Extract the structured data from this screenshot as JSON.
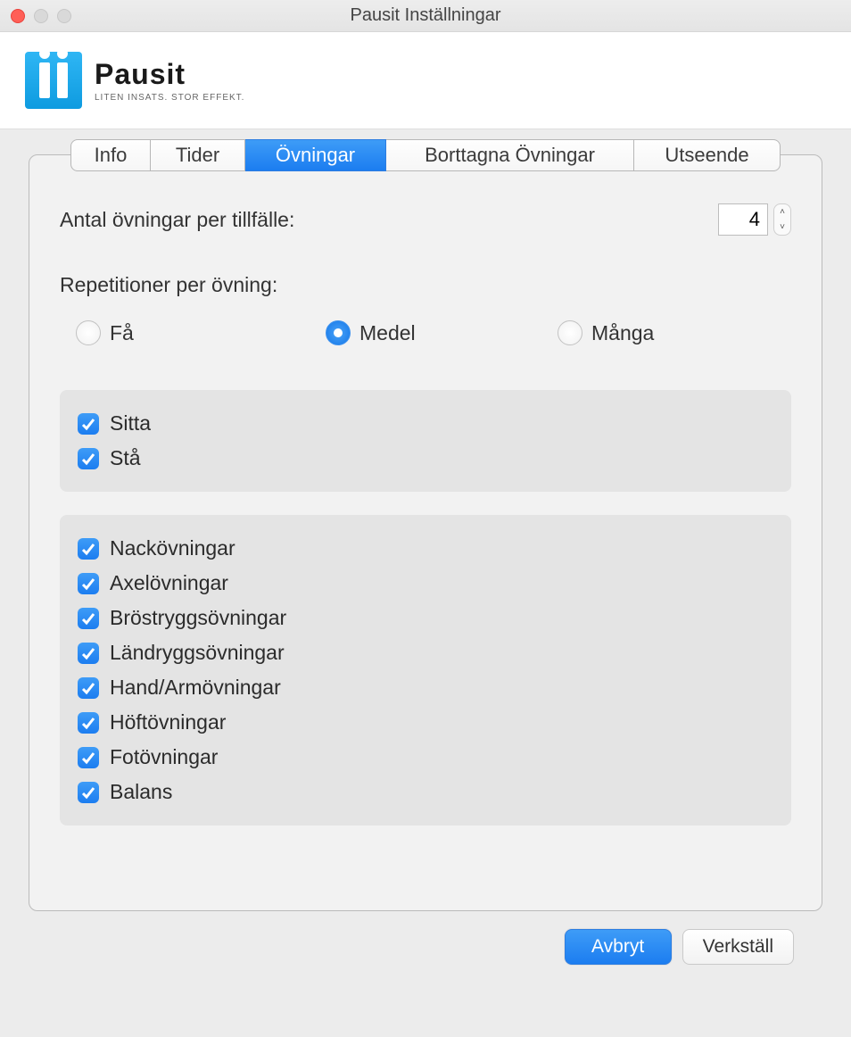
{
  "window": {
    "title": "Pausit Inställningar"
  },
  "logo": {
    "text": "Pausit",
    "tagline": "LITEN INSATS. STOR EFFEKT."
  },
  "tabs": {
    "info": "Info",
    "tider": "Tider",
    "ovningar": "Övningar",
    "borttagna": "Borttagna Övningar",
    "utseende": "Utseende",
    "active": "ovningar"
  },
  "exercises": {
    "count_label": "Antal övningar per tillfälle:",
    "count_value": "4",
    "reps_label": "Repetitioner per övning:",
    "reps_options": {
      "few": "Få",
      "medium": "Medel",
      "many": "Många"
    },
    "reps_selected": "medium",
    "positions": [
      {
        "label": "Sitta",
        "checked": true
      },
      {
        "label": "Stå",
        "checked": true
      }
    ],
    "categories": [
      {
        "label": "Nackövningar",
        "checked": true
      },
      {
        "label": "Axelövningar",
        "checked": true
      },
      {
        "label": "Bröstryggsövningar",
        "checked": true
      },
      {
        "label": "Ländryggsövningar",
        "checked": true
      },
      {
        "label": "Hand/Armövningar",
        "checked": true
      },
      {
        "label": "Höftövningar",
        "checked": true
      },
      {
        "label": "Fotövningar",
        "checked": true
      },
      {
        "label": "Balans",
        "checked": true
      }
    ]
  },
  "buttons": {
    "cancel": "Avbryt",
    "apply": "Verkställ"
  }
}
